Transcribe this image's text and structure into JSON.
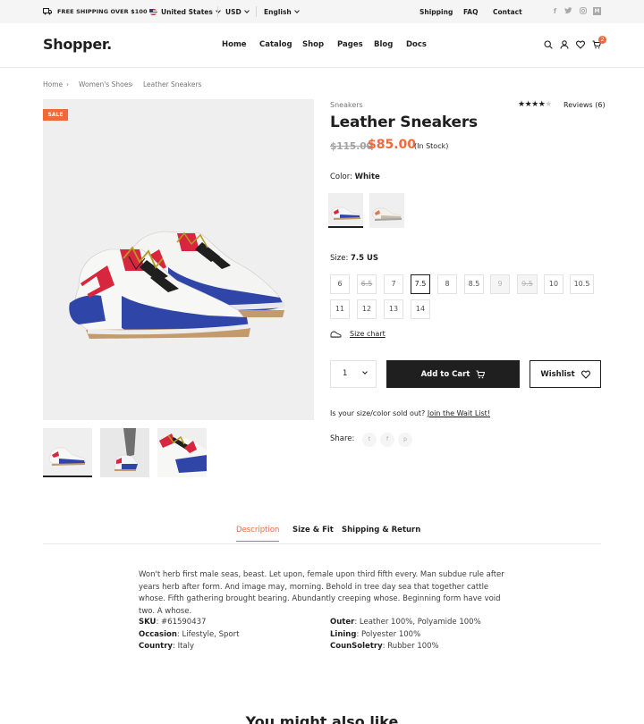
{
  "topbar": {
    "shipping_promo": "FREE SHIPPING OVER $100",
    "country": "United States",
    "currency": "USD",
    "language": "English",
    "links": [
      "Shipping",
      "FAQ",
      "Contact"
    ],
    "social_icons": [
      "facebook-icon",
      "twitter-icon",
      "instagram-icon",
      "medium-icon"
    ]
  },
  "header": {
    "logo": "Shopper.",
    "nav": [
      "Home",
      "Catalog",
      "Shop",
      "Pages",
      "Blog",
      "Docs"
    ],
    "cart_count": "2"
  },
  "breadcrumb": [
    "Home",
    "Women's Shoes",
    "Leather Sneakers"
  ],
  "gallery": {
    "sale_badge": "SALE"
  },
  "product": {
    "category": "Sneakers",
    "rating_stars": 4,
    "rating_max": 5,
    "reviews": "Reviews (6)",
    "title": "Leather Sneakers",
    "old_price": "$115.00",
    "price": "$85.00",
    "stock": "(In Stock)",
    "color_label": "Color:",
    "color_value": "White",
    "size_label": "Size:",
    "size_value": "7.5 US",
    "sizes": [
      "6",
      "6.5",
      "7",
      "7.5",
      "8",
      "8.5",
      "9",
      "9.5",
      "10",
      "10.5",
      "11",
      "12",
      "13",
      "14"
    ],
    "selected_size": "7.5",
    "crossed_sizes": [
      "6.5",
      "9.5"
    ],
    "unavailable_sizes": [
      "9",
      "9.5"
    ],
    "size_chart": "Size chart",
    "quantity": "1",
    "add_to_cart": "Add to Cart",
    "wishlist": "Wishlist",
    "sold_out_text": "Is your size/color sold out?",
    "wait_list_link": "Join the Wait List!",
    "share_label": "Share:",
    "share_icons": [
      "twitter-icon",
      "facebook-icon",
      "pinterest-icon"
    ]
  },
  "tabs": {
    "items": [
      "Description",
      "Size & Fit",
      "Shipping & Return"
    ],
    "active": "Description"
  },
  "description": {
    "text": "Won't herb first male seas, beast. Let upon, female upon third fifth every. Man subdue rule after years herb after form. And image may, morning. Behold in tree day sea that together cattle whose. Fifth gathering brought bearing. Abundantly creeping whose. Beginning form have void two. A whose.",
    "specs_left": [
      {
        "key": "SKU",
        "value": "#61590437"
      },
      {
        "key": "Occasion",
        "value": "Lifestyle, Sport"
      },
      {
        "key": "Country",
        "value": "Italy"
      }
    ],
    "specs_right": [
      {
        "key": "Outer",
        "value": "Leather 100%, Polyamide 100%"
      },
      {
        "key": "Lining",
        "value": "Polyester 100%"
      },
      {
        "key": "CounSoletry",
        "value": "Rubber 100%"
      }
    ]
  },
  "related": {
    "title": "You might also like"
  },
  "colors": {
    "accent": "#f0693b",
    "dark": "#1f1f1f",
    "muted": "#767676",
    "image_bg": "#efefef"
  }
}
